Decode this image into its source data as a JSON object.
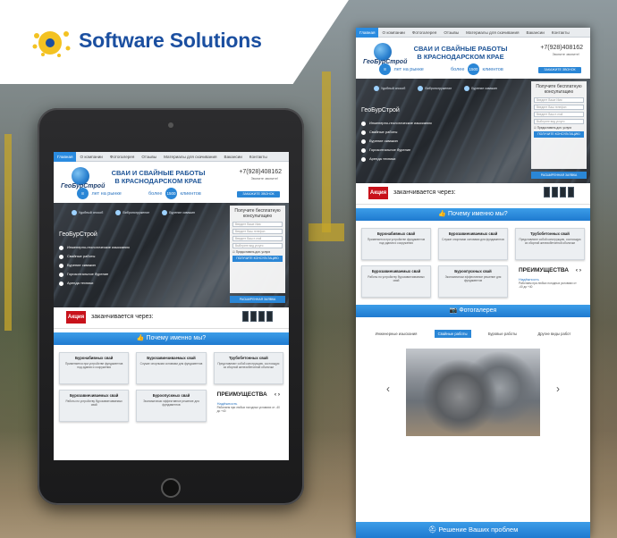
{
  "brand": {
    "name": "Software Solutions"
  },
  "site": {
    "nav": [
      "Главная",
      "О компании",
      "Фотогалерея",
      "Отзывы",
      "Материалы для скачивания",
      "Вакансии",
      "Контакты"
    ],
    "logo_text": "ГеоБурСтрой",
    "title_line1": "СВАИ И СВАЙНЫЕ РАБОТЫ",
    "title_line2": "В КРАСНОДАРСКОМ КРАЕ",
    "phone": "+7(928)408162",
    "phone_note": "Звоните звоните!",
    "callback_button": "ЗАКАЖИТЕ ЗВОНОК",
    "stat_years_num": "8",
    "stat_years_label": "лет на рынке",
    "stat_clients_prefix": "более",
    "stat_clients_num": "1500",
    "stat_clients_label": "клиентов",
    "hero_features": [
      "Удобный способ",
      "Вибропогружение",
      "Бурение скважин"
    ],
    "hero_company": "ГеоБурСтрой",
    "hero_services": [
      "Инженерно-геологические изыскания",
      "Свайные работы",
      "Бурение скважин",
      "Горизонтальное бурение",
      "Аренда техники"
    ],
    "form_title": "Получите бесплатную консультацию",
    "form_fields": [
      "Введите Ваше Имя",
      "Введите Ваш телефон",
      "Введите Ваш e-mail",
      "Выберите вид услуги"
    ],
    "form_check": "Предоставить доп. услуги",
    "form_submit": "ПОЛУЧИТЕ КОНСУЛЬТАЦИЮ",
    "form_extended": "РАСШИРЕННАЯ ЗАЯВКА",
    "promo_tag": "Акция",
    "promo_text": "заканчивается через:",
    "why_title": "Почему именно мы?",
    "cards": [
      {
        "title": "Буронабивных свай",
        "text": "Применяется при устройстве фундаментов под здания и сооружения"
      },
      {
        "title": "Бурозавинчиваемых свай",
        "text": "Служат опорными основами для фундаментов"
      },
      {
        "title": "Трубобетонных свай",
        "text": "Представляют собой конструкцию, состоящую из сборной железобетонной оболочки"
      },
      {
        "title": "Бурозавинчиваемых свай",
        "text": "Работы по устройству бурозавинчиваемых свай"
      },
      {
        "title": "Буроопускных свай",
        "text": "Экономически эффективное решение для фундаментов"
      }
    ],
    "adv_title": "ПРЕИМУЩЕСТВА",
    "adv_item_title": "Надёжность",
    "adv_item_text": "Работаем при любых погодных условиях от -40 до +40",
    "gallery_title": "Фотогалерея",
    "gallery_tabs": [
      "Инженерные изыскания",
      "Свайные работы",
      "Буровые работы",
      "Другие виды работ"
    ],
    "footer_title": "Решение Ваших проблем"
  }
}
